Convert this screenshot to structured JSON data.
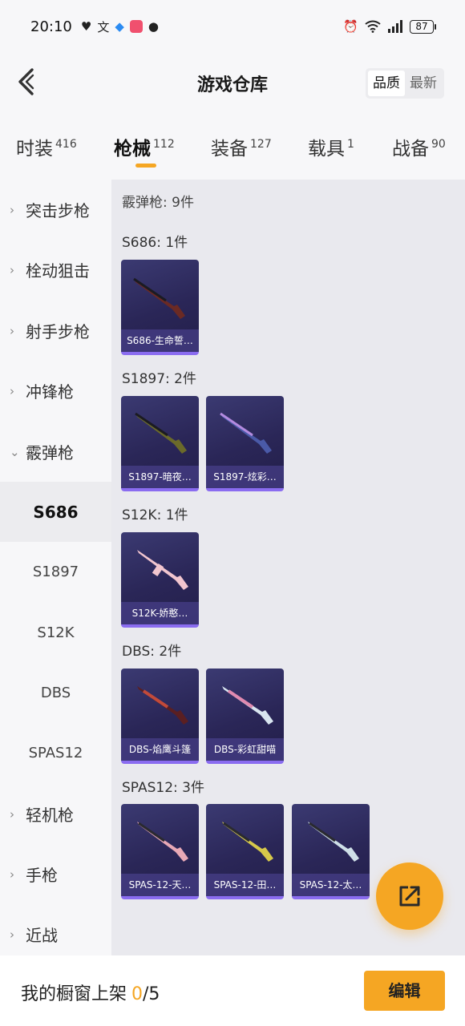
{
  "status_bar": {
    "time": "20:10",
    "battery": "87",
    "icons": [
      "shield-heart-icon",
      "translate-icon",
      "app-icon",
      "app-icon",
      "chat-icon",
      "alarm-icon",
      "wifi-icon",
      "signal-icon"
    ]
  },
  "header": {
    "title": "游戏仓库",
    "sort_options": [
      "品质",
      "最新"
    ],
    "active_sort": "品质"
  },
  "category_tabs": [
    {
      "label": "时装",
      "count": "416"
    },
    {
      "label": "枪械",
      "count": "112",
      "active": true
    },
    {
      "label": "装备",
      "count": "127"
    },
    {
      "label": "载具",
      "count": "1"
    },
    {
      "label": "战备",
      "count": "90"
    }
  ],
  "sidebar": {
    "items": [
      {
        "label": "突击步枪"
      },
      {
        "label": "栓动狙击"
      },
      {
        "label": "射手步枪"
      },
      {
        "label": "冲锋枪"
      },
      {
        "label": "霰弹枪",
        "expanded": true
      },
      {
        "label": "S686",
        "sub": true,
        "active": true
      },
      {
        "label": "S1897",
        "sub": true
      },
      {
        "label": "S12K",
        "sub": true
      },
      {
        "label": "DBS",
        "sub": true
      },
      {
        "label": "SPAS12",
        "sub": true
      },
      {
        "label": "轻机枪"
      },
      {
        "label": "手枪"
      },
      {
        "label": "近战"
      }
    ]
  },
  "content": {
    "total_label": "霰弹枪: 9件",
    "groups": [
      {
        "label": "S686: 1件",
        "items": [
          "S686-生命誓…"
        ]
      },
      {
        "label": "S1897: 2件",
        "items": [
          "S1897-暗夜…",
          "S1897-炫彩…"
        ]
      },
      {
        "label": "S12K: 1件",
        "items": [
          "S12K-娇憨…"
        ]
      },
      {
        "label": "DBS: 2件",
        "items": [
          "DBS-焰鹰斗篷",
          "DBS-彩虹甜喵"
        ]
      },
      {
        "label": "SPAS12: 3件",
        "items": [
          "SPAS-12-天…",
          "SPAS-12-田…",
          "SPAS-12-太…"
        ]
      }
    ]
  },
  "bottom_bar": {
    "shelf_label": "我的橱窗上架",
    "shelf_current": "0",
    "shelf_total": "/5",
    "edit_label": "编辑"
  },
  "colors": {
    "accent": "#f5a623",
    "card_bg": "#2a2657",
    "card_border": "#8a6cf0"
  }
}
